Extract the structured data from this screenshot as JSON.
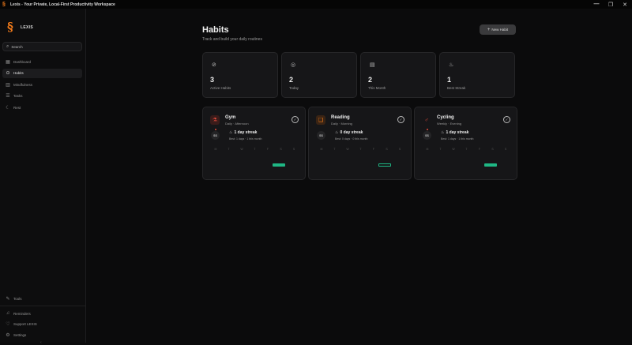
{
  "window": {
    "title": "Lexis - Your Private, Local-First Productivity Workspace",
    "controls": [
      "—",
      "❐",
      "✕"
    ]
  },
  "sidebar": {
    "brand": "LEXIS",
    "search_label": "Search",
    "items": [
      {
        "label": "Dashboard",
        "icon": "grid-icon"
      },
      {
        "label": "Habits",
        "icon": "check-circle-icon",
        "active": true
      },
      {
        "label": "Mindfulness",
        "icon": "brain-icon"
      },
      {
        "label": "Tasks",
        "icon": "list-icon"
      },
      {
        "label": "Rest",
        "icon": "sleep-icon"
      }
    ],
    "tools_label": "Tools",
    "bottom": [
      {
        "label": "Reminders",
        "icon": "bell-icon"
      },
      {
        "label": "Support LEXIS",
        "icon": "heart-icon"
      },
      {
        "label": "Settings",
        "icon": "gear-icon"
      }
    ],
    "collapse_glyph": "‹"
  },
  "header": {
    "title": "Habits",
    "subtitle": "Track and build your daily routines",
    "new_button": "New Habit"
  },
  "stats": [
    {
      "value": "3",
      "label": "Active Habits",
      "icon": "check-circle-icon"
    },
    {
      "value": "2",
      "label": "Today",
      "icon": "target-icon"
    },
    {
      "value": "2",
      "label": "This Month",
      "icon": "calendar-icon"
    },
    {
      "value": "1",
      "label": "Best Streak",
      "icon": "flame-icon"
    }
  ],
  "habits": [
    {
      "name": "Gym",
      "schedule": "Daily · Afternoon",
      "icon": "dumbbell-icon",
      "icon_color": "#e24a3b",
      "icon_bg": "#3a1c1a",
      "day": "SS",
      "streak": "1 day streak",
      "best": "Best: 1 days · 1 this month",
      "bar": "filled"
    },
    {
      "name": "Reading",
      "schedule": "Daily · Morning",
      "icon": "book-icon",
      "icon_color": "#f07a1a",
      "icon_bg": "#3a2414",
      "day": "SS",
      "streak": "0 day streak",
      "best": "Best: 0 days · 0 this month",
      "bar": "outline"
    },
    {
      "name": "Cycling",
      "schedule": "Weekly · Evening",
      "icon": "bike-icon",
      "icon_color": "#e24a3b",
      "icon_bg": "#161618",
      "day": "SS",
      "streak": "1 day streak",
      "best": "Best: 1 days · 1 this month",
      "bar": "filled"
    }
  ],
  "weekdays": [
    "M",
    "T",
    "W",
    "T",
    "F",
    "S",
    "S"
  ],
  "colors": {
    "accent": "#f07a1a",
    "success": "#1fb784",
    "background": "#0b0b0c",
    "card": "#161618"
  }
}
